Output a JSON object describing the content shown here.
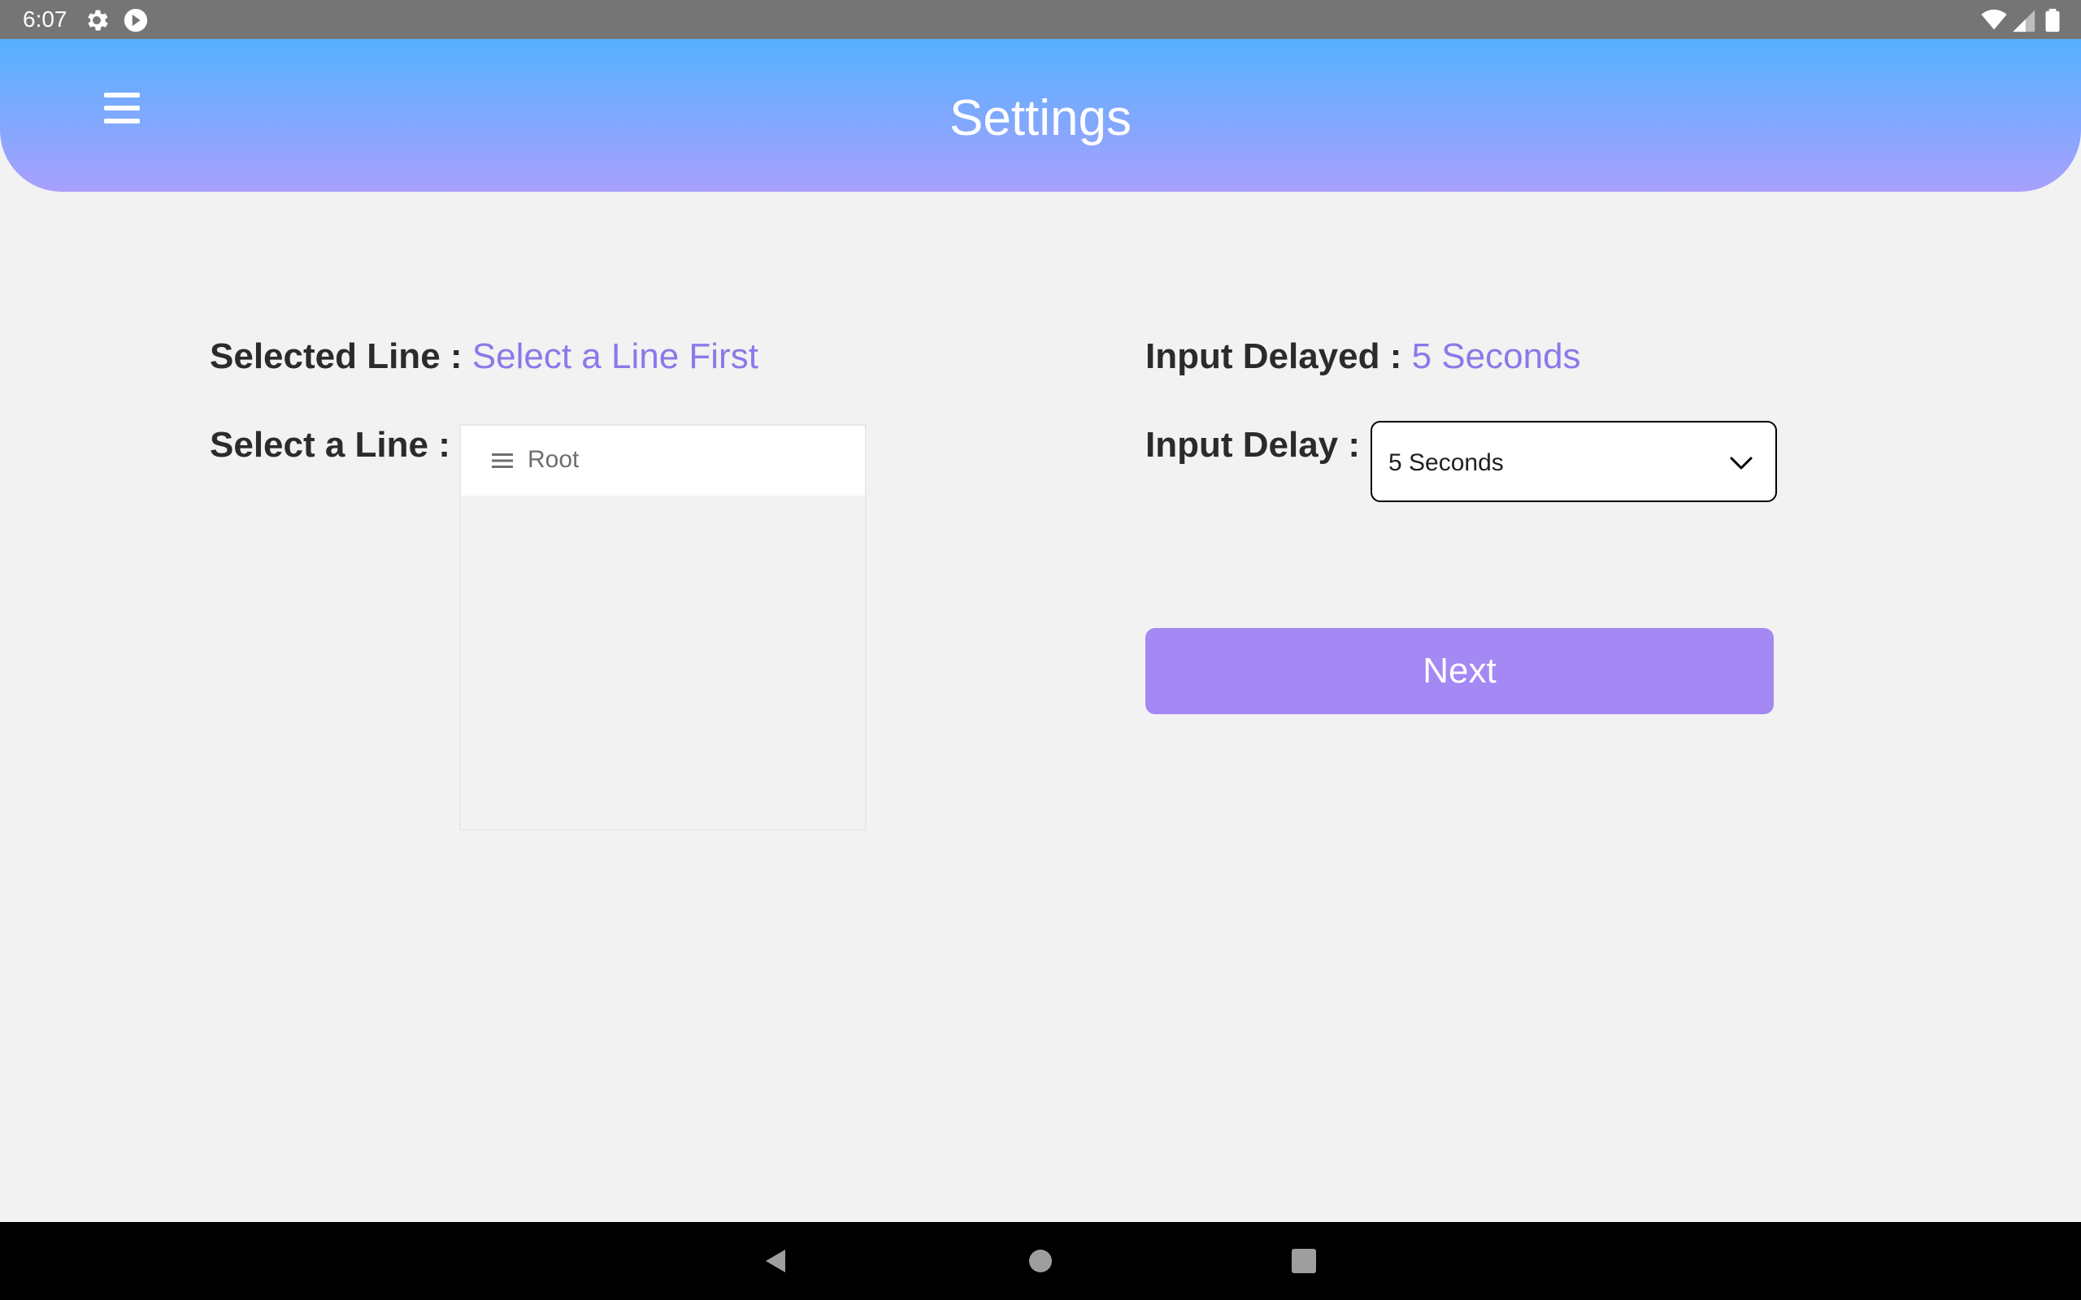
{
  "status_bar": {
    "time": "6:07",
    "icons_left": [
      "gear-icon",
      "sync-icon"
    ],
    "icons_right": [
      "wifi-icon",
      "signal-icon",
      "battery-icon"
    ]
  },
  "header": {
    "title": "Settings",
    "menu_icon": "hamburger-menu-icon",
    "gradient_top": "#55b1fe",
    "gradient_bottom": "#a8a0fe"
  },
  "left_panel": {
    "selected_line_label": "Selected Line :",
    "selected_line_value": "Select a Line First",
    "select_line_label": "Select a Line :",
    "tree": {
      "root_icon": "list-icon",
      "root_label": "Root"
    }
  },
  "right_panel": {
    "input_delayed_label": "Input Delayed :",
    "input_delayed_value": "5 Seconds",
    "input_delay_label": "Input Delay :",
    "input_delay_selected": "5 Seconds",
    "next_button": "Next"
  },
  "nav_bar": {
    "buttons": [
      "back-icon",
      "home-icon",
      "recents-icon"
    ]
  },
  "colors": {
    "accent": "#8a79ea",
    "button": "#a488f4",
    "background": "#f2f2f2"
  }
}
